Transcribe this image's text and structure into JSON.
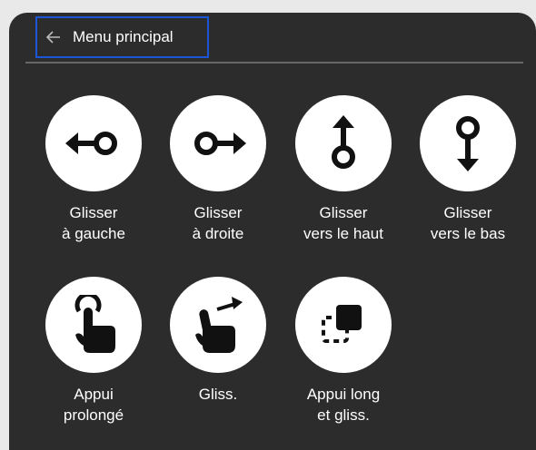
{
  "header": {
    "back_label": "Menu principal",
    "back_icon": "arrow-left-icon"
  },
  "gestures": [
    {
      "label": "Glisser\nà gauche",
      "icon": "swipe-left-icon"
    },
    {
      "label": "Glisser\nà droite",
      "icon": "swipe-right-icon"
    },
    {
      "label": "Glisser\nvers le haut",
      "icon": "swipe-up-icon"
    },
    {
      "label": "Glisser\nvers le bas",
      "icon": "swipe-down-icon"
    },
    {
      "label": "Appui\nprolongé",
      "icon": "long-press-icon"
    },
    {
      "label": "Gliss.",
      "icon": "drag-icon"
    },
    {
      "label": "Appui long\net gliss.",
      "icon": "long-press-drag-icon"
    }
  ],
  "colors": {
    "panel_bg": "#2c2c2c",
    "focus_outline": "#1a56d6",
    "icon_circle": "#ffffff",
    "text": "#ffffff"
  }
}
